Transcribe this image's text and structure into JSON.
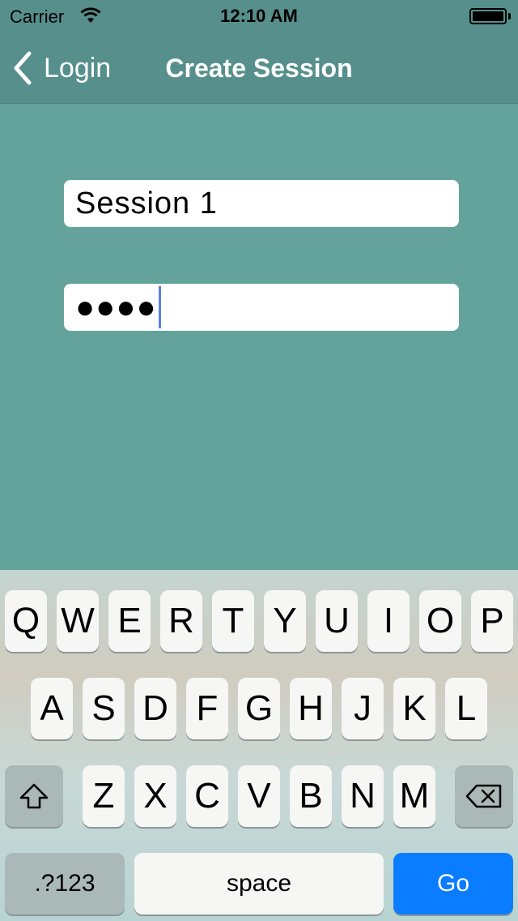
{
  "status_bar": {
    "carrier": "Carrier",
    "time": "12:10 AM"
  },
  "nav": {
    "back_label": "Login",
    "title": "Create Session"
  },
  "form": {
    "session_name_value": "Session 1",
    "password_masked": "●●●●"
  },
  "keyboard": {
    "row1": [
      "Q",
      "W",
      "E",
      "R",
      "T",
      "Y",
      "U",
      "I",
      "O",
      "P"
    ],
    "row2": [
      "A",
      "S",
      "D",
      "F",
      "G",
      "H",
      "J",
      "K",
      "L"
    ],
    "row3": [
      "Z",
      "X",
      "C",
      "V",
      "B",
      "N",
      "M"
    ],
    "numbers_label": ".?123",
    "space_label": "space",
    "go_label": "Go"
  },
  "colors": {
    "background": "#64a29c",
    "header": "#568f8b",
    "go_key": "#0a7cff",
    "caret": "#5a7fe8"
  }
}
